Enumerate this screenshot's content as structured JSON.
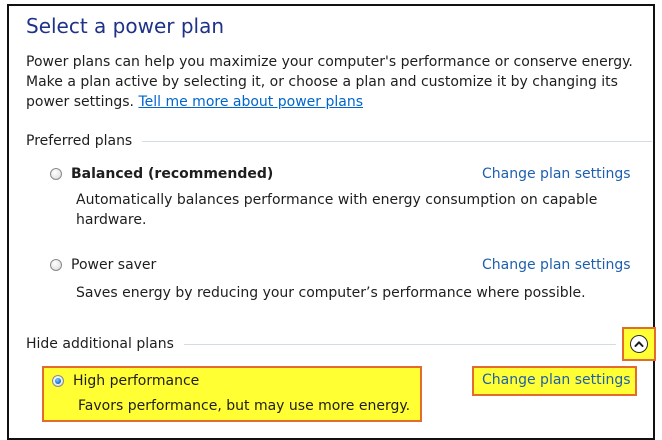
{
  "header": {
    "title": "Select a power plan",
    "intro_text": "Power plans can help you maximize your computer's performance or conserve energy. Make a plan active by selecting it, or choose a plan and customize it by changing its power settings.",
    "intro_link": "Tell me more about power plans"
  },
  "preferred": {
    "heading": "Preferred plans",
    "plans": [
      {
        "name": "Balanced (recommended)",
        "description": "Automatically balances performance with energy consumption on capable hardware.",
        "change_link": "Change plan settings",
        "selected": false
      },
      {
        "name": "Power saver",
        "description": "Saves energy by reducing your computer’s performance where possible.",
        "change_link": "Change plan settings",
        "selected": false
      }
    ]
  },
  "additional": {
    "heading": "Hide additional plans",
    "collapse_icon": "chevron-up-icon",
    "plans": [
      {
        "name": "High performance",
        "description": "Favors performance, but may use more energy.",
        "change_link": "Change plan settings",
        "selected": true
      }
    ]
  },
  "colors": {
    "title": "#1e3287",
    "link": "#1e5fae",
    "highlight": "#ffff33",
    "annotation_outline": "#e36b2c"
  }
}
